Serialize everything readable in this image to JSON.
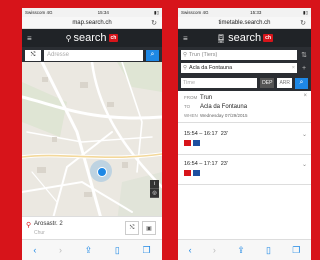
{
  "left": {
    "status": {
      "carrier": "Swisscom",
      "network": "4G",
      "time": "15:34"
    },
    "url": "map.search.ch",
    "header": {
      "title": "search",
      "badge": "ch"
    },
    "search": {
      "placeholder": "Adresse"
    },
    "map": {
      "street": "Arosastr."
    },
    "infobar": {
      "address": "Arosastr. 2",
      "place": "Chur"
    }
  },
  "right": {
    "status": {
      "carrier": "Swisscom",
      "network": "4G",
      "time": "15:33"
    },
    "url": "timetable.search.ch",
    "header": {
      "title": "search",
      "badge": "ch"
    },
    "form": {
      "from_placeholder": "Trun (Tiers)",
      "to_value": "Acla da Fontauna",
      "time_placeholder": "Time",
      "dep_label": "DEP",
      "arr_label": "ARR"
    },
    "summary": {
      "from_label": "FROM",
      "from_value": "Trun",
      "to_label": "TO",
      "to_value": "Acla da Fontauna",
      "when_label": "WHEN",
      "when_value": "Wednesday 07/29/2015"
    },
    "connections": [
      {
        "times": "15:54 – 16:17",
        "duration": "23'"
      },
      {
        "times": "16:54 – 17:17",
        "duration": "23'"
      }
    ]
  },
  "colors": {
    "brand": "#d7141a",
    "accent": "#1e88e5",
    "header": "#202327"
  }
}
